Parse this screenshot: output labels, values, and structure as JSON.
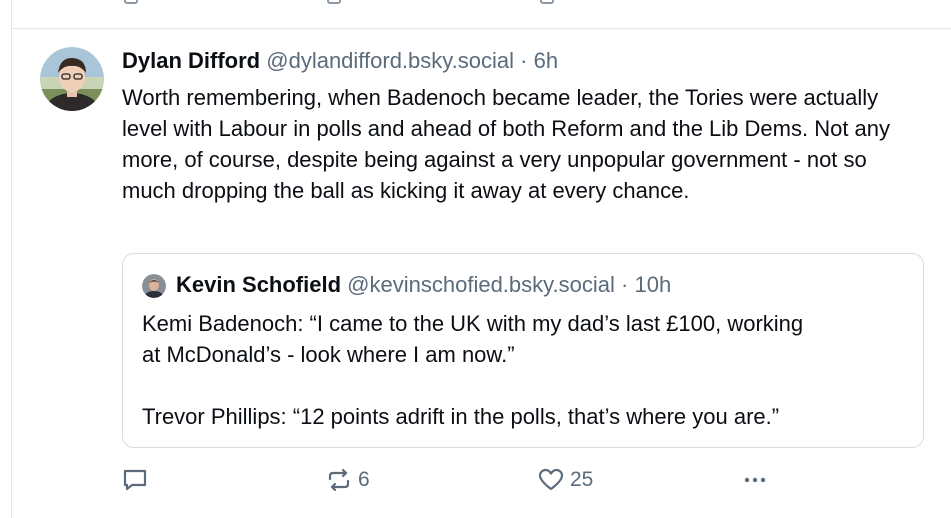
{
  "post": {
    "author_name": "Dylan Difford",
    "handle": "@dylandifford.bsky.social",
    "separator": "·",
    "time": "6h",
    "text": "Worth remembering, when Badenoch became leader, the Tories were actually level with Labour in polls and ahead of both Reform and the Lib Dems. Not any more, of course, despite being against a very unpopular government - not so much dropping the ball as kicking it away at every chance.",
    "quote": {
      "author_name": "Kevin Schofield",
      "handle": "@kevinschofied.bsky.social",
      "separator": "·",
      "time": "10h",
      "lines": [
        "Kemi Badenoch: “I came to the UK with my dad’s last £100, working",
        "at McDonald’s - look where I am now.”",
        "",
        "Trevor Phillips: “12 points adrift in the polls, that’s where you are.”"
      ]
    },
    "actions": {
      "reply_icon": "reply-icon",
      "repost_icon": "repost-icon",
      "repost_count": "6",
      "like_icon": "heart-icon",
      "like_count": "25",
      "more_icon": "more-icon"
    }
  },
  "colors": {
    "text": "#0b0f14",
    "muted": "#5b6b7c",
    "border": "#d6dde4"
  }
}
